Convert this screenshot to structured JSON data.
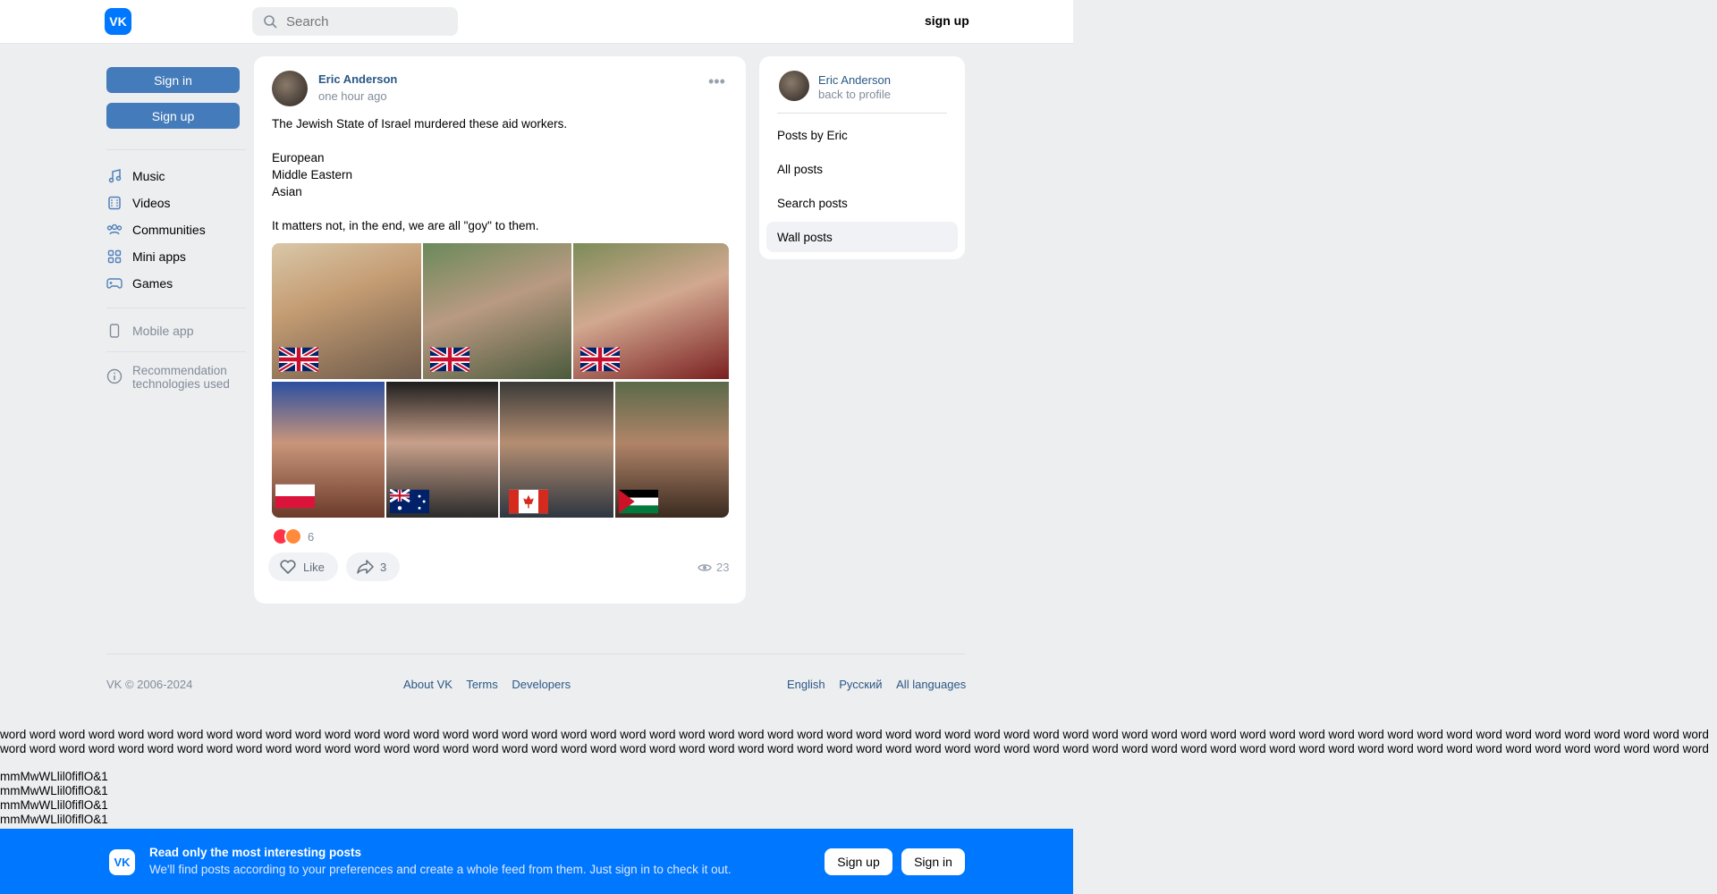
{
  "header": {
    "logo_text": "VK",
    "search_placeholder": "Search",
    "signup_link": "sign up"
  },
  "sidebar": {
    "signin_label": "Sign in",
    "signup_label": "Sign up",
    "items": [
      {
        "label": "Music",
        "icon": "music-icon"
      },
      {
        "label": "Videos",
        "icon": "videos-icon"
      },
      {
        "label": "Communities",
        "icon": "communities-icon"
      },
      {
        "label": "Mini apps",
        "icon": "mini-apps-icon"
      },
      {
        "label": "Games",
        "icon": "games-icon"
      }
    ],
    "mobile_app": "Mobile app",
    "recommendation_line1": "Recommendation",
    "recommendation_line2": "technologies used"
  },
  "post": {
    "author": "Eric Anderson",
    "time": "one hour ago",
    "text_line1": "The Jewish State of Israel murdered these aid workers.",
    "text_line2": "European",
    "text_line3": "Middle Eastern",
    "text_line4": "Asian",
    "text_line5": "It matters not, in the end, we are all \"goy\" to them.",
    "reaction_count": "6",
    "like_label": "Like",
    "share_count": "3",
    "views": "23",
    "photos": [
      {
        "flag": "uk"
      },
      {
        "flag": "uk"
      },
      {
        "flag": "uk"
      },
      {
        "flag": "poland"
      },
      {
        "flag": "australia"
      },
      {
        "flag": "canada"
      },
      {
        "flag": "palestine"
      }
    ]
  },
  "right_panel": {
    "name": "Eric Anderson",
    "back": "back to profile",
    "items": [
      "Posts by Eric",
      "All posts",
      "Search posts",
      "Wall posts"
    ],
    "active_item": "Wall posts"
  },
  "footer": {
    "copyright": "VK © 2006-2024",
    "links": [
      "About VK",
      "Terms",
      "Developers"
    ],
    "languages": [
      "English",
      "Русский",
      "All languages"
    ]
  },
  "junk_text": {
    "words_line": "word word word word word word word word word word word word word word word word word word word word word word word word word word word word word word word word word word word word word word word word word word word word word word word word word word word word word word word word word word",
    "glyph_line": "mmMwWLlil0fiflO&1"
  },
  "banner": {
    "title": "Read only the most interesting posts",
    "subtitle": "We'll find posts according to your preferences and create a whole feed from them. Just sign in to check it out.",
    "signup": "Sign up",
    "signin": "Sign in"
  }
}
